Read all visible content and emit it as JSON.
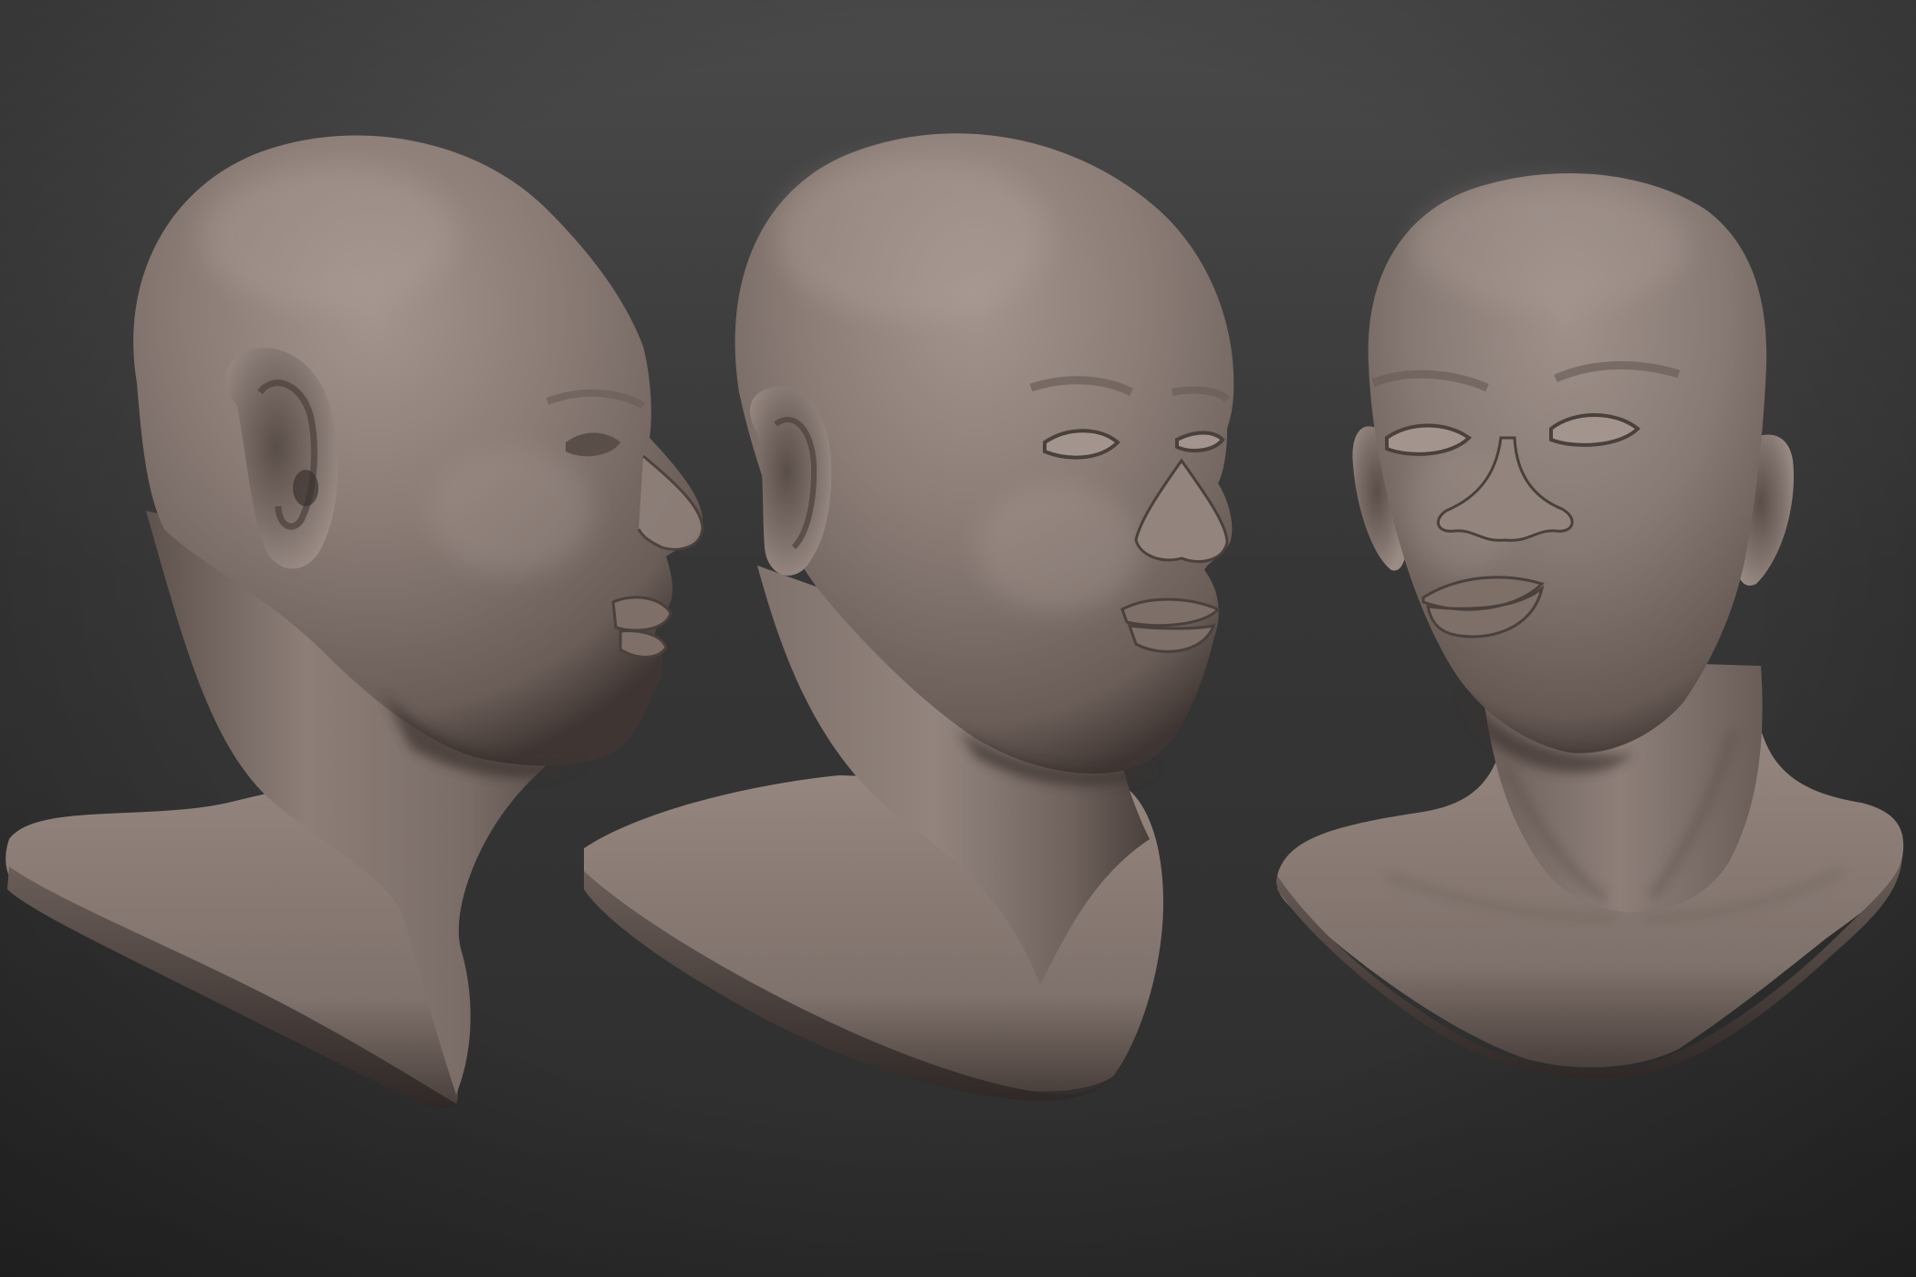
{
  "scene": {
    "background_top": "#4a4a4a",
    "background_mid": "#363636",
    "background_bottom": "#2e2e2e",
    "material": {
      "light": "#a3958e",
      "base": "#857670",
      "mid": "#6b5e59",
      "shadow": "#3a322f",
      "deep": "#262120"
    },
    "busts": [
      {
        "view": "side-profile"
      },
      {
        "view": "three-quarter"
      },
      {
        "view": "front"
      }
    ]
  }
}
